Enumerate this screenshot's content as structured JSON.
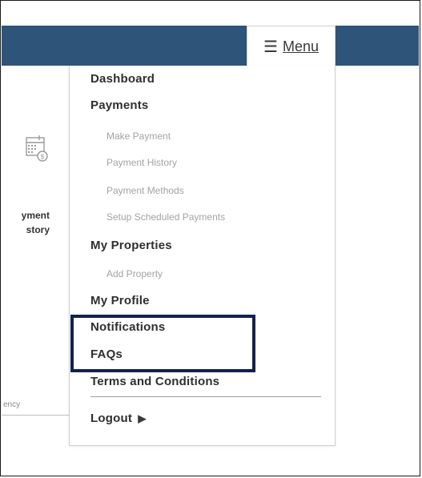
{
  "header": {
    "menu_label": "Menu",
    "menu_icon": "hamburger-icon",
    "bar_color": "#2e5479"
  },
  "background": {
    "icon": "calendar-dollar-icon",
    "card_line1": "yment",
    "card_line2": "story",
    "footer_text": "ency"
  },
  "menu": {
    "items": [
      {
        "label": "Dashboard"
      },
      {
        "label": "Payments"
      },
      {
        "label": "Make Payment"
      },
      {
        "label": "Payment History"
      },
      {
        "label": "Payment Methods"
      },
      {
        "label": "Setup Scheduled Payments"
      },
      {
        "label": "My Properties"
      },
      {
        "label": "Add Property"
      },
      {
        "label": "My Profile"
      },
      {
        "label": "Notifications"
      },
      {
        "label": "FAQs"
      },
      {
        "label": "Terms and Conditions"
      },
      {
        "label": "Logout"
      }
    ],
    "logout_icon": "logout-arrow-icon"
  },
  "annotation": {
    "box_color": "#12224d"
  }
}
